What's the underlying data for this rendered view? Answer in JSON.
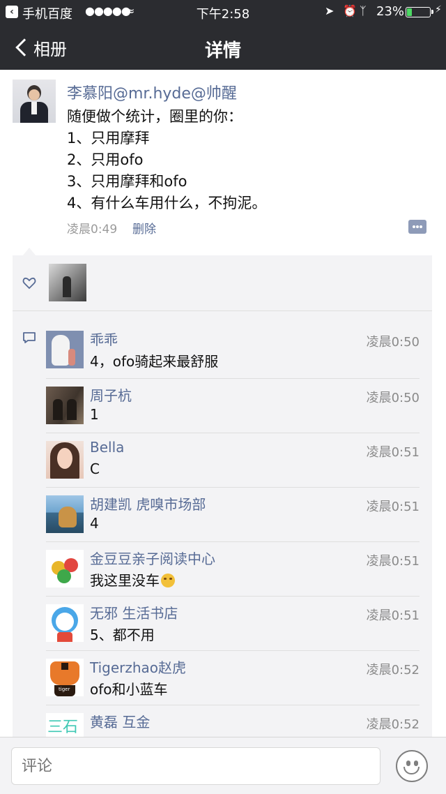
{
  "status_bar": {
    "app_name": "手机百度",
    "signal": "●●●●●",
    "time": "下午2:58",
    "battery": "23%",
    "battery_level": 0.23
  },
  "nav": {
    "back_label": "相册",
    "title": "详情"
  },
  "post": {
    "author": "李慕阳@mr.hyde@帅醒",
    "lines": [
      "随便做个统计，圈里的你：",
      "1、只用摩拜",
      "2、只用ofo",
      "3、只用摩拜和ofo",
      "4、有什么车用什么，不拘泥。"
    ],
    "time": "凌晨0:49",
    "delete_label": "删除"
  },
  "comments": [
    {
      "name": "乖乖",
      "time": "凌晨0:50",
      "text": "4，ofo骑起来最舒服"
    },
    {
      "name": "周子杭",
      "time": "凌晨0:50",
      "text": "1"
    },
    {
      "name": "Bella",
      "time": "凌晨0:51",
      "text": "C"
    },
    {
      "name": "胡建凯 虎嗅市场部",
      "time": "凌晨0:51",
      "text": "4"
    },
    {
      "name": "金豆豆亲子阅读中心",
      "time": "凌晨0:51",
      "text": "我这里没车"
    },
    {
      "name": "无邪 生活书店",
      "time": "凌晨0:51",
      "text": "5、都不用"
    },
    {
      "name": "Tigerzhao赵虎",
      "time": "凌晨0:52",
      "text": "ofo和小蓝车"
    },
    {
      "name": "黄磊 互金",
      "time": "凌晨0:52",
      "text": ""
    }
  ],
  "avatar_labels": {
    "tiger": "tiger",
    "huang": "三石"
  },
  "input": {
    "placeholder": "评论"
  },
  "colors": {
    "nav_bg": "#2b2c30",
    "name_link": "#576b95",
    "panel_bg": "#f3f3f5"
  }
}
